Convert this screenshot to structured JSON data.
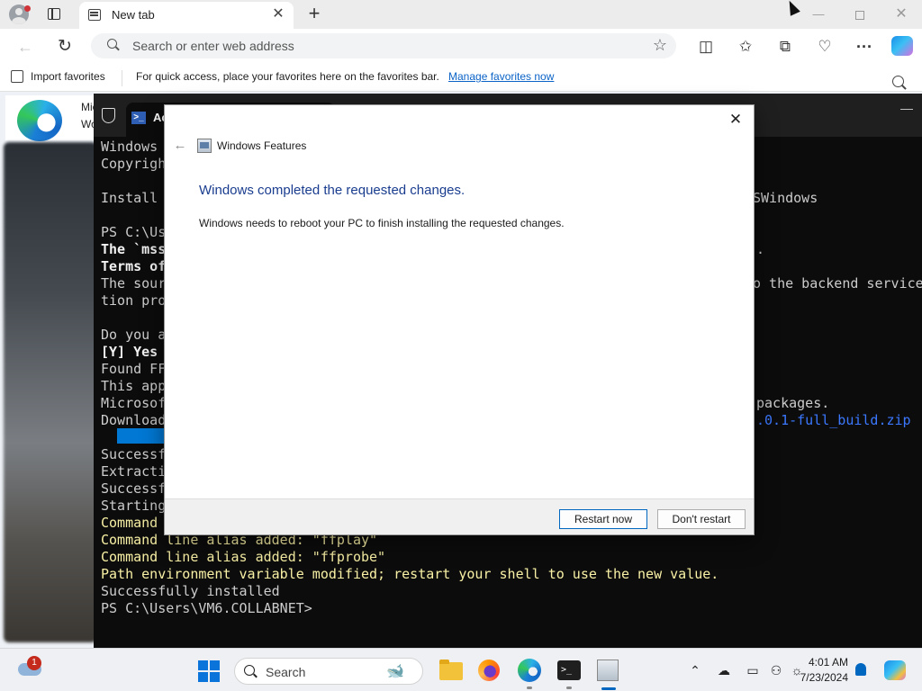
{
  "browser": {
    "tab_title": "New tab",
    "tab_close": "✕",
    "new_tab": "+",
    "address_placeholder": "Search or enter web address",
    "window_controls": {
      "minimize": "—",
      "close": "✕"
    },
    "favorites_bar": {
      "import_label": "Import favorites",
      "message": "For quick access, place your favorites here on the favorites bar.",
      "manage_link": "Manage favorites now"
    },
    "toolbar_icons": [
      "split-screen-icon",
      "favorites-icon",
      "collections-icon",
      "performance-icon",
      "more-icon",
      "copilot-icon"
    ]
  },
  "page": {
    "card_line1": "Mic",
    "card_line2": "Wo"
  },
  "terminal": {
    "tab_title": "Ac",
    "tab_icon": ">_",
    "minimize": "—",
    "lines": [
      {
        "text": "Windows ",
        "style": "c-white"
      },
      {
        "text": "Copyrigh",
        "style": "c-white"
      },
      {
        "text": "",
        "style": "c-white"
      },
      {
        "text": "Install ",
        "style": "c-white"
      },
      {
        "text": "",
        "style": "c-white"
      },
      {
        "text": "PS C:\\Us",
        "style": "c-white"
      },
      {
        "text": "The `mss",
        "style": "c-bold"
      },
      {
        "text": "Terms of",
        "style": "c-bold"
      },
      {
        "text": "The sour",
        "style": "c-white"
      },
      {
        "text": "tion pro",
        "style": "c-white"
      },
      {
        "text": "",
        "style": "c-white"
      },
      {
        "text": "Do you a",
        "style": "c-white"
      },
      {
        "text": "[Y] Yes ",
        "style": "c-bold"
      },
      {
        "text": "Found FF",
        "style": "c-white"
      },
      {
        "text": "This app",
        "style": "c-white"
      },
      {
        "text": "Microsof",
        "style": "c-white"
      },
      {
        "text": "Download",
        "style": "c-white"
      },
      {
        "text": "",
        "style": "c-white"
      },
      {
        "text": "Successf",
        "style": "c-white"
      },
      {
        "text": "Extracti",
        "style": "c-white"
      },
      {
        "text": "Successf",
        "style": "c-white"
      },
      {
        "text": "Starting",
        "style": "c-white"
      },
      {
        "text": "Command ",
        "style": "c-yellow"
      },
      {
        "text": "Command line alias added: \"ffplay\"",
        "style": "c-yellow"
      },
      {
        "text": "Command line alias added: \"ffprobe\"",
        "style": "c-yellow"
      },
      {
        "text": "Path environment variable modified; restart your shell to use the new value.",
        "style": "c-yellow"
      },
      {
        "text": "Successfully installed",
        "style": "c-white"
      },
      {
        "text": "PS C:\\Users\\VM6.COLLABNET>",
        "style": "c-white"
      }
    ],
    "right_fragments": {
      "r1": "SWindows",
      "r2": ".",
      "r3": "o the backend service",
      "r4": "packages.",
      "r5": ".0.1-full_build.zip"
    }
  },
  "dialog": {
    "close": "✕",
    "back": "←",
    "app_title": "Windows Features",
    "heading": "Windows completed the requested changes.",
    "body": "Windows needs to reboot your PC to finish installing the requested changes.",
    "restart_button": "Restart now",
    "dont_restart_button": "Don't restart"
  },
  "taskbar": {
    "weather_badge": "1",
    "search_label": "Search",
    "time": "4:01 AM",
    "date": "7/23/2024",
    "tray_icons": [
      "chevron-up-icon",
      "cloud-offline-icon",
      "display-icon",
      "accessibility-icon",
      "weather-tray-icon"
    ]
  }
}
